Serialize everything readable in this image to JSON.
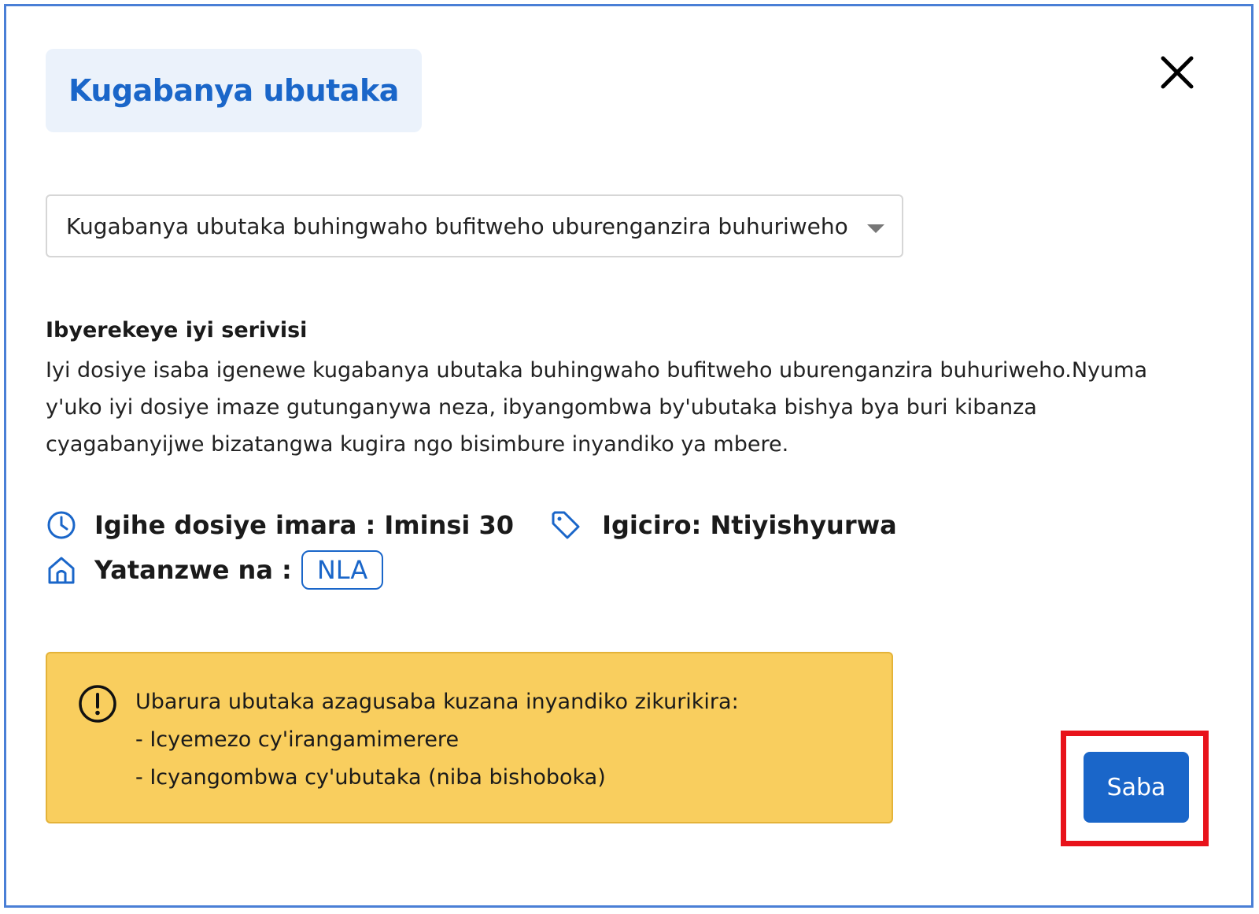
{
  "dialog": {
    "title": "Kugabanya ubutaka",
    "close_icon": "close-icon"
  },
  "service_select": {
    "selected_value": "Kugabanya ubutaka buhingwaho bufitweho uburenganzira buhuriweho"
  },
  "about": {
    "heading": "Ibyerekeye iyi serivisi",
    "text": "Iyi dosiye isaba igenewe kugabanya ubutaka buhingwaho bufitweho uburenganzira buhuriweho.Nyuma y'uko iyi dosiye imaze gutunganywa neza, ibyangombwa by'ubutaka bishya bya buri kibanza cyagabanyijwe bizatangwa kugira ngo bisimbure inyandiko ya mbere."
  },
  "meta": {
    "duration": "Igihe dosiye imara : Iminsi 30",
    "price": "Igiciro: Ntiyishyurwa",
    "provider_label": "Yatanzwe na :",
    "provider_badge": "NLA",
    "icons": [
      "clock-icon",
      "price-tag-icon",
      "home-icon"
    ]
  },
  "notice": {
    "lines": [
      "Ubarura ubutaka azagusaba kuzana inyandiko zikurikira:",
      "- Icyemezo cy'irangamimerere",
      "- Icyangombwa cy'ubutaka (niba bishoboka)"
    ],
    "icon": "alert-circle-icon"
  },
  "actions": {
    "submit_label": "Saba"
  },
  "colors": {
    "accent": "#1a66c9",
    "title_bg": "#ebf2fb",
    "notice_bg": "#f9ce5e",
    "highlight": "#e8131b",
    "frame": "#4a7fd6"
  }
}
